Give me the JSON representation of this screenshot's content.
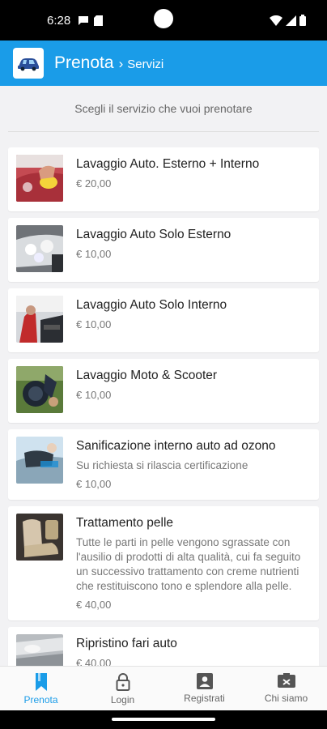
{
  "status": {
    "time": "6:28",
    "icons": [
      "message-icon",
      "sim-card-icon",
      "wifi-icon",
      "signal-icon",
      "battery-icon"
    ]
  },
  "header": {
    "title": "Prenota",
    "separator": "›",
    "subtitle": "Servizi",
    "logo_icon": "car-wash-logo",
    "accent": "#1a9ce8"
  },
  "intro": "Scegli il servizio che vuoi prenotare",
  "services": [
    {
      "title": "Lavaggio Auto. Esterno + Interno",
      "desc": "",
      "price": "€ 20,00"
    },
    {
      "title": "Lavaggio Auto Solo Esterno",
      "desc": "",
      "price": "€ 10,00"
    },
    {
      "title": "Lavaggio Auto Solo Interno",
      "desc": "",
      "price": "€ 10,00"
    },
    {
      "title": "Lavaggio Moto & Scooter",
      "desc": "",
      "price": "€ 10,00"
    },
    {
      "title": "Sanificazione interno auto ad ozono",
      "desc": "Su richiesta si rilascia certificazione",
      "price": "€ 10,00"
    },
    {
      "title": "Trattamento pelle",
      "desc": "Tutte le parti in pelle vengono sgrassate con l'ausilio di prodotti di alta qualità, cui fa seguito un successivo trattamento con creme nutrienti che restituiscono tono e splendore alla pelle.",
      "price": "€ 40,00"
    },
    {
      "title": "Ripristino fari auto",
      "desc": "",
      "price": "€ 40,00"
    }
  ],
  "nav": [
    {
      "label": "Prenota",
      "icon": "bookmark-icon",
      "active": true
    },
    {
      "label": "Login",
      "icon": "lock-icon",
      "active": false
    },
    {
      "label": "Registrati",
      "icon": "account-box-icon",
      "active": false
    },
    {
      "label": "Chi siamo",
      "icon": "contact-card-icon",
      "active": false
    }
  ]
}
